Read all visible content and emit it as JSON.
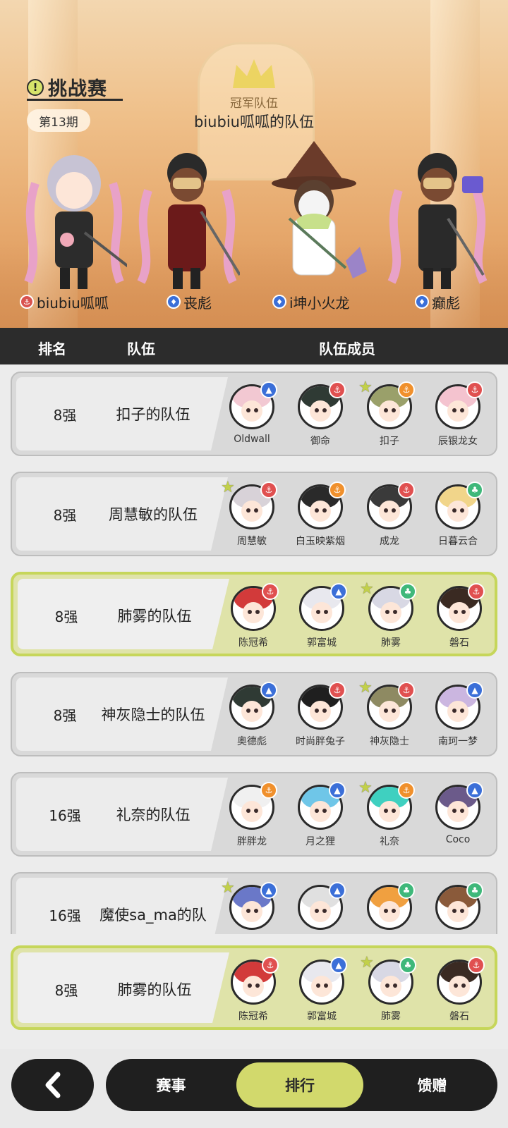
{
  "header": {
    "title": "挑战赛",
    "title_icon": "exclamation-icon",
    "period": "第13期",
    "champion_label": "冠军队伍",
    "champion_team": "biubiu呱呱的队伍",
    "champions": [
      {
        "name": "biubiu呱呱",
        "element": "red",
        "element_icon": "anchor-icon"
      },
      {
        "name": "丧彪",
        "element": "blue",
        "element_icon": "flame-icon"
      },
      {
        "name": "i坤小火龙",
        "element": "blue",
        "element_icon": "flame-icon"
      },
      {
        "name": "癫彪",
        "element": "blue",
        "element_icon": "flame-icon"
      }
    ]
  },
  "table_header": {
    "rank": "排名",
    "team": "队伍",
    "members": "队伍成员"
  },
  "rows": [
    {
      "rank": "8强",
      "team": "扣子的队伍",
      "highlight": false,
      "members": [
        {
          "name": "Oldwall",
          "element": "#3b6fd8",
          "star": false
        },
        {
          "name": "御命",
          "element": "#e05050",
          "star": false
        },
        {
          "name": "扣子",
          "element": "#f0902c",
          "star": true
        },
        {
          "name": "辰银龙女",
          "element": "#e05050",
          "star": false
        }
      ]
    },
    {
      "rank": "8强",
      "team": "周慧敏的队伍",
      "highlight": false,
      "members": [
        {
          "name": "周慧敏",
          "element": "#e05050",
          "star": true
        },
        {
          "name": "白玉映紫烟",
          "element": "#f0902c",
          "star": false
        },
        {
          "name": "成龙",
          "element": "#e05050",
          "star": false
        },
        {
          "name": "日暮云合",
          "element": "#3fb87a",
          "star": false
        }
      ]
    },
    {
      "rank": "8强",
      "team": "肺雾的队伍",
      "highlight": true,
      "members": [
        {
          "name": "陈冠希",
          "element": "#e05050",
          "star": false
        },
        {
          "name": "郭富城",
          "element": "#3b6fd8",
          "star": false
        },
        {
          "name": "肺雾",
          "element": "#3fb87a",
          "star": true
        },
        {
          "name": "磐石",
          "element": "#e05050",
          "star": false
        }
      ]
    },
    {
      "rank": "8强",
      "team": "神灰隐士的队伍",
      "highlight": false,
      "members": [
        {
          "name": "奥德彪",
          "element": "#3b6fd8",
          "star": false
        },
        {
          "name": "时尚胖兔子",
          "element": "#e05050",
          "star": false
        },
        {
          "name": "神灰隐士",
          "element": "#e05050",
          "star": true
        },
        {
          "name": "南珂一梦",
          "element": "#3b6fd8",
          "star": false
        }
      ]
    },
    {
      "rank": "16强",
      "team": "礼奈的队伍",
      "highlight": false,
      "members": [
        {
          "name": "胖胖龙",
          "element": "#f0902c",
          "star": false
        },
        {
          "name": "月之狸",
          "element": "#3b6fd8",
          "star": false
        },
        {
          "name": "礼奈",
          "element": "#f0902c",
          "star": true
        },
        {
          "name": "Coco",
          "element": "#3b6fd8",
          "star": false
        }
      ]
    },
    {
      "rank": "16强",
      "team": "魔使sa_ma的队",
      "highlight": false,
      "members": [
        {
          "name": "",
          "element": "#3b6fd8",
          "star": true
        },
        {
          "name": "",
          "element": "#3b6fd8",
          "star": false
        },
        {
          "name": "",
          "element": "#3fb87a",
          "star": false
        },
        {
          "name": "",
          "element": "#3fb87a",
          "star": false
        }
      ]
    }
  ],
  "my_team": {
    "rank": "8强",
    "team": "肺雾的队伍",
    "highlight": true,
    "members": [
      {
        "name": "陈冠希",
        "element": "#e05050",
        "star": false
      },
      {
        "name": "郭富城",
        "element": "#3b6fd8",
        "star": false
      },
      {
        "name": "肺雾",
        "element": "#3fb87a",
        "star": true
      },
      {
        "name": "磐石",
        "element": "#e05050",
        "star": false
      }
    ]
  },
  "bottom_nav": {
    "back_icon": "chevron-left-icon",
    "tabs": [
      "赛事",
      "排行",
      "馈赠"
    ],
    "active": "排行"
  },
  "colors": {
    "accent": "#d2d96c",
    "dark": "#1f1f1f",
    "header_bg": "#2c2c2c"
  }
}
